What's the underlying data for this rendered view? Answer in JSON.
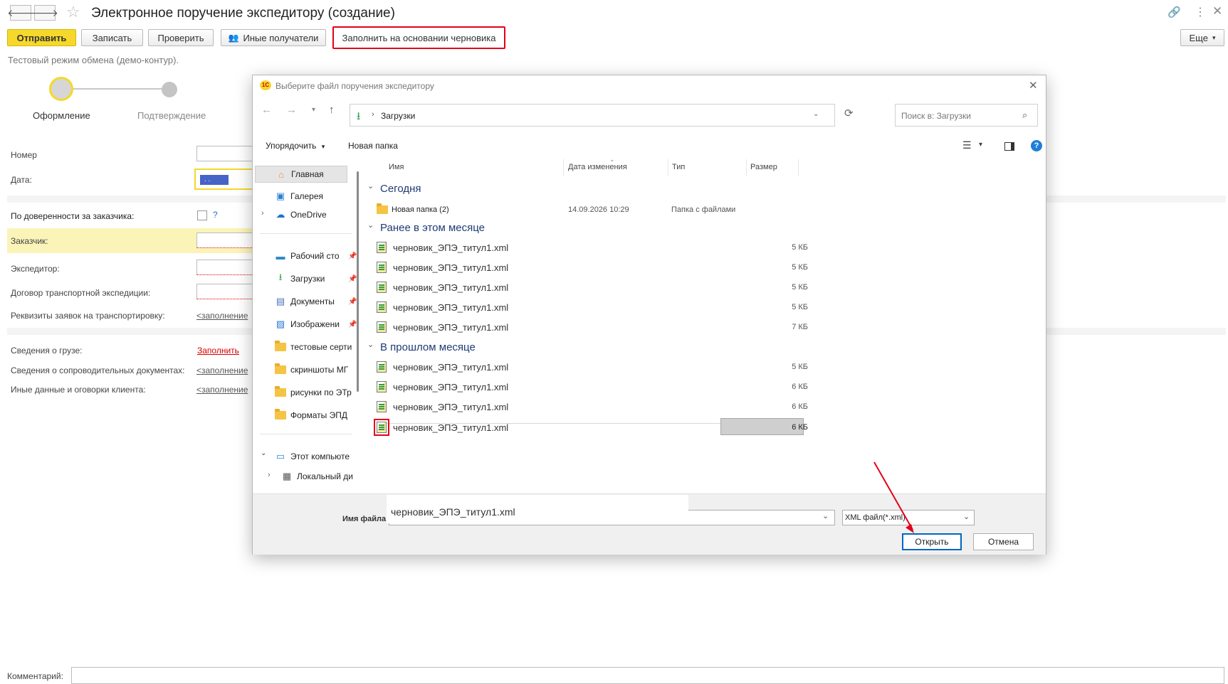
{
  "window": {
    "title": "Электронное поручение экспедитору (создание)",
    "back_icon": "arrow-left-icon",
    "forward_icon": "arrow-right-icon",
    "star_icon": "star-icon",
    "link_icon": "link-icon",
    "menu_icon": "more-vertical-icon",
    "close_icon": "close-icon"
  },
  "toolbar": {
    "send": "Отправить",
    "save": "Записать",
    "check": "Проверить",
    "other_recipients": "Иные получатели",
    "fill_from_draft": "Заполнить на основании черновика",
    "more": "Еще"
  },
  "mode_note": "Тестовый режим обмена (демо-контур).",
  "steps": [
    "Оформление",
    "Подтверждение"
  ],
  "form": {
    "number_label": "Номер",
    "date_label": "Дата:",
    "date_value": ". .",
    "proxy_label": "По доверенности за заказчика:",
    "proxy_help": "?",
    "customer_label": "Заказчик:",
    "forwarder_label": "Экспедитор:",
    "contract_label": "Договор транспортной экспедиции:",
    "requests_label": "Реквизиты заявок на транспортировку:",
    "requests_value": "<заполнение",
    "cargo_label": "Сведения о грузе:",
    "cargo_value": "Заполнить",
    "docs_label": "Сведения о сопроводительных документах:",
    "docs_value": "<заполнение",
    "other_label": "Иные данные и оговорки клиента:",
    "other_value": "<заполнение",
    "comment_label": "Комментарий:"
  },
  "dialog": {
    "title": "Выберите файл поручения экспедитору",
    "logo": "1С",
    "path": "Загрузки",
    "search_placeholder": "Поиск в: Загрузки",
    "organize": "Упорядочить",
    "new_folder": "Новая папка",
    "columns": [
      "Имя",
      "Дата изменения",
      "Тип",
      "Размер"
    ],
    "sidebar": [
      {
        "label": "Главная",
        "icon": "home-icon"
      },
      {
        "label": "Галерея",
        "icon": "gallery-icon"
      },
      {
        "label": "OneDrive",
        "icon": "cloud-icon"
      },
      {
        "label": "Рабочий сто",
        "icon": "desktop-icon"
      },
      {
        "label": "Загрузки",
        "icon": "download-icon"
      },
      {
        "label": "Документы",
        "icon": "document-icon"
      },
      {
        "label": "Изображени",
        "icon": "image-icon"
      },
      {
        "label": "тестовые серти",
        "icon": "folder-icon"
      },
      {
        "label": "скриншоты МГ",
        "icon": "folder-icon"
      },
      {
        "label": "рисунки по ЭТр",
        "icon": "folder-icon"
      },
      {
        "label": "Форматы ЭПД",
        "icon": "folder-icon"
      },
      {
        "label": "Этот компьюте",
        "icon": "computer-icon"
      },
      {
        "label": "Локальный ди",
        "icon": "drive-icon"
      }
    ],
    "groups": {
      "today": "Сегодня",
      "this_month": "Ранее в этом месяце",
      "last_month": "В прошлом месяце"
    },
    "today_items": [
      {
        "name": "Новая папка (2)",
        "date": "14.09.2026 10:29",
        "type": "Папка с файлами"
      }
    ],
    "month_items": [
      {
        "name": "черновик_ЭПЭ_титул1.xml",
        "size": "5 КБ"
      },
      {
        "name": "черновик_ЭПЭ_титул1.xml",
        "size": "5 КБ"
      },
      {
        "name": "черновик_ЭПЭ_титул1.xml",
        "size": "5 КБ"
      },
      {
        "name": "черновик_ЭПЭ_титул1.xml",
        "size": "5 КБ"
      },
      {
        "name": "черновик_ЭПЭ_титул1.xml",
        "size": "7 КБ"
      }
    ],
    "last_month_items": [
      {
        "name": "черновик_ЭПЭ_титул1.xml",
        "size": "5 КБ"
      },
      {
        "name": "черновик_ЭПЭ_титул1.xml",
        "size": "6 КБ"
      },
      {
        "name": "черновик_ЭПЭ_титул1.xml",
        "size": "6 КБ"
      },
      {
        "name": "черновик_ЭПЭ_титул1.xml",
        "size": "6 КБ"
      }
    ],
    "filename_label": "Имя файла:",
    "filename_value": "черновик_ЭПЭ_титул1.xml",
    "filter": "XML файл(*.xml)",
    "open": "Открыть",
    "cancel": "Отмена"
  },
  "colors": {
    "accent_yellow": "#f5d82b",
    "highlight_red": "#e3001b",
    "required_bg": "#fbf4b8",
    "selection_blue": "#4763c7"
  }
}
